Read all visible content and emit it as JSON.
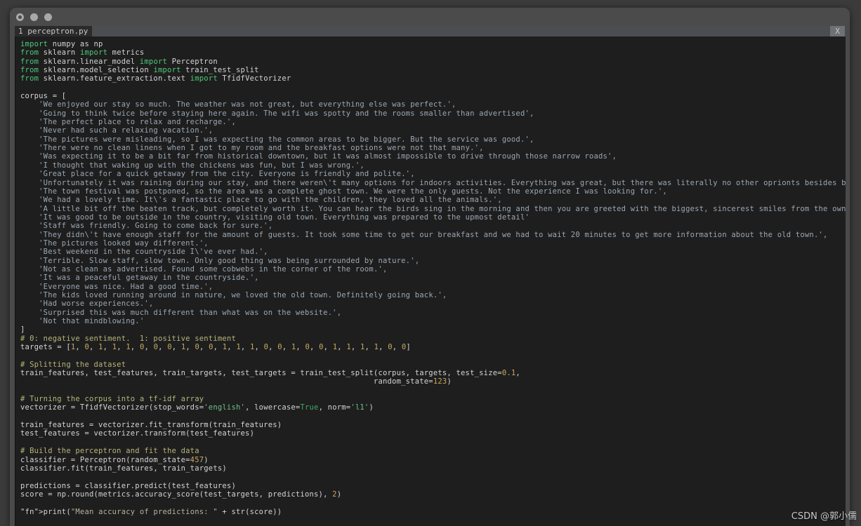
{
  "window": {
    "traffic_lights": [
      "close",
      "minimize",
      "zoom"
    ],
    "background_color": "#3b3b3b",
    "titlebar_color": "#4b4b4b"
  },
  "tabbar": {
    "active_tab_label": "1 perceptron.py",
    "close_label": "X"
  },
  "editor": {
    "background_color": "#1e1e1e",
    "language": "python",
    "filename": "perceptron.py",
    "code": "import numpy as np\nfrom sklearn import metrics\nfrom sklearn.linear_model import Perceptron\nfrom sklearn.model_selection import train_test_split\nfrom sklearn.feature_extraction.text import TfidfVectorizer\n\ncorpus = [\n    'We enjoyed our stay so much. The weather was not great, but everything else was perfect.',\n    'Going to think twice before staying here again. The wifi was spotty and the rooms smaller than advertised',\n    'The perfect place to relax and recharge.',\n    'Never had such a relaxing vacation.',\n    'The pictures were misleading, so I was expecting the common areas to be bigger. But the service was good.',\n    'There were no clean linens when I got to my room and the breakfast options were not that many.',\n    'Was expecting it to be a bit far from historical downtown, but it was almost impossible to drive through those narrow roads',\n    'I thought that waking up with the chickens was fun, but I was wrong.',\n    'Great place for a quick getaway from the city. Everyone is friendly and polite.',\n    'Unfortunately it was raining during our stay, and there weren\\'t many options for indoors activities. Everything was great, but there was literally no other oprionts besides being in the rain.',\n    'The town festival was postponed, so the area was a complete ghost town. We were the only guests. Not the experience I was looking for.',\n    'We had a lovely time. It\\'s a fantastic place to go with the children, they loved all the animals.',\n    'A little bit off the beaten track, but completely worth it. You can hear the birds sing in the morning and then you are greeted with the biggest, sincerest smiles from the owners. Loved it!',\n    'It was good to be outside in the country, visiting old town. Everything was prepared to the upmost detail'\n    'Staff was friendly. Going to come back for sure.',\n    'They didn\\'t have enough staff for the amount of guests. It took some time to get our breakfast and we had to wait 20 minutes to get more information about the old town.',\n    'The pictures looked way different.',\n    'Best weekend in the countryside I\\'ve ever had.',\n    'Terrible. Slow staff, slow town. Only good thing was being surrounded by nature.',\n    'Not as clean as advertised. Found some cobwebs in the corner of the room.',\n    'It was a peaceful getaway in the countryside.',\n    'Everyone was nice. Had a good time.',\n    'The kids loved running around in nature, we loved the old town. Definitely going back.',\n    'Had worse experiences.',\n    'Surprised this was much different than what was on the website.',\n    'Not that mindblowing.'\n]\n# 0: negative sentiment.  1: positive sentiment\ntargets = [1, 0, 1, 1, 1, 0, 0, 0, 1, 0, 0, 1, 1, 1, 0, 0, 1, 0, 0, 1, 1, 1, 1, 0, 0]\n\n# Splitting the dataset\ntrain_features, test_features, train_targets, test_targets = train_test_split(corpus, targets, test_size=0.1,\n                                                                             random_state=123)\n\n# Turning the corpus into a tf-idf array\nvectorizer = TfidfVectorizer(stop_words='english', lowercase=True, norm='l1')\n\ntrain_features = vectorizer.fit_transform(train_features)\ntest_features = vectorizer.transform(test_features)\n\n# Build the perceptron and fit the data\nclassifier = Perceptron(random_state=457)\nclassifier.fit(train_features, train_targets)\n\npredictions = classifier.predict(test_features)\nscore = np.round(metrics.accuracy_score(test_targets, predictions), 2)\n\nprint(\"Mean accuracy of predictions: \" + str(score))",
    "tokens": {
      "keywords": [
        "import",
        "from"
      ],
      "booleans": [
        "True"
      ],
      "builtins": [
        "print"
      ],
      "numbers": [
        "0",
        "1",
        "0.1",
        "123",
        "457",
        "2",
        "20"
      ],
      "inline_strings": [
        "'english'",
        "'l1'"
      ],
      "comments": [
        "# 0: negative sentiment.  1: positive sentiment",
        "# Splitting the dataset",
        "# Turning the corpus into a tf-idf array",
        "# Build the perceptron and fit the data"
      ]
    },
    "colors": {
      "keyword": "#4ec97a",
      "string": "#9aa7b4",
      "comment": "#b5b57a",
      "number": "#c8a95f",
      "builtin": "#c586c0",
      "text": "#d4d4d4"
    }
  },
  "watermark": {
    "text": "CSDN @郭小儒"
  }
}
